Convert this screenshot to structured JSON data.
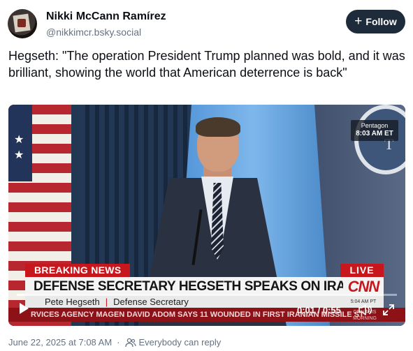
{
  "author": {
    "display_name": "Nikki McCann Ramírez",
    "handle": "@nikkimcr.bsky.social"
  },
  "follow_button": {
    "icon": "+",
    "label": "Follow"
  },
  "post_text": "Hegseth:  \"The operation President Trump planned was bold, and it was brilliant, showing the world that American deterrence is back\"",
  "video": {
    "corner_tag_line1": "Pentagon",
    "corner_tag_line2": "8:03 AM ET",
    "seal_letter": "T",
    "breaking_label": "BREAKING NEWS",
    "live_label": "LIVE",
    "headline": "DEFENSE SECRETARY HEGSETH SPEAKS ON IRAN STRIKES",
    "network_logo": "CNN",
    "speaker_name": "Pete Hegseth",
    "speaker_title": "Defense Secretary",
    "lower_time": "5:04 AM PT",
    "ticker": "RVICES AGENCY MAGEN DAVID ADOM SAYS 11 WOUNDED IN FIRST IRANIAN MISSILE ST",
    "ticker_logo": "CNN THIS MORNING",
    "timecode": "0:01 / 0:55",
    "progress_fraction": 0.02
  },
  "footer": {
    "timestamp": "June 22, 2025 at 7:08 AM",
    "reply_setting": "Everybody can reply"
  }
}
